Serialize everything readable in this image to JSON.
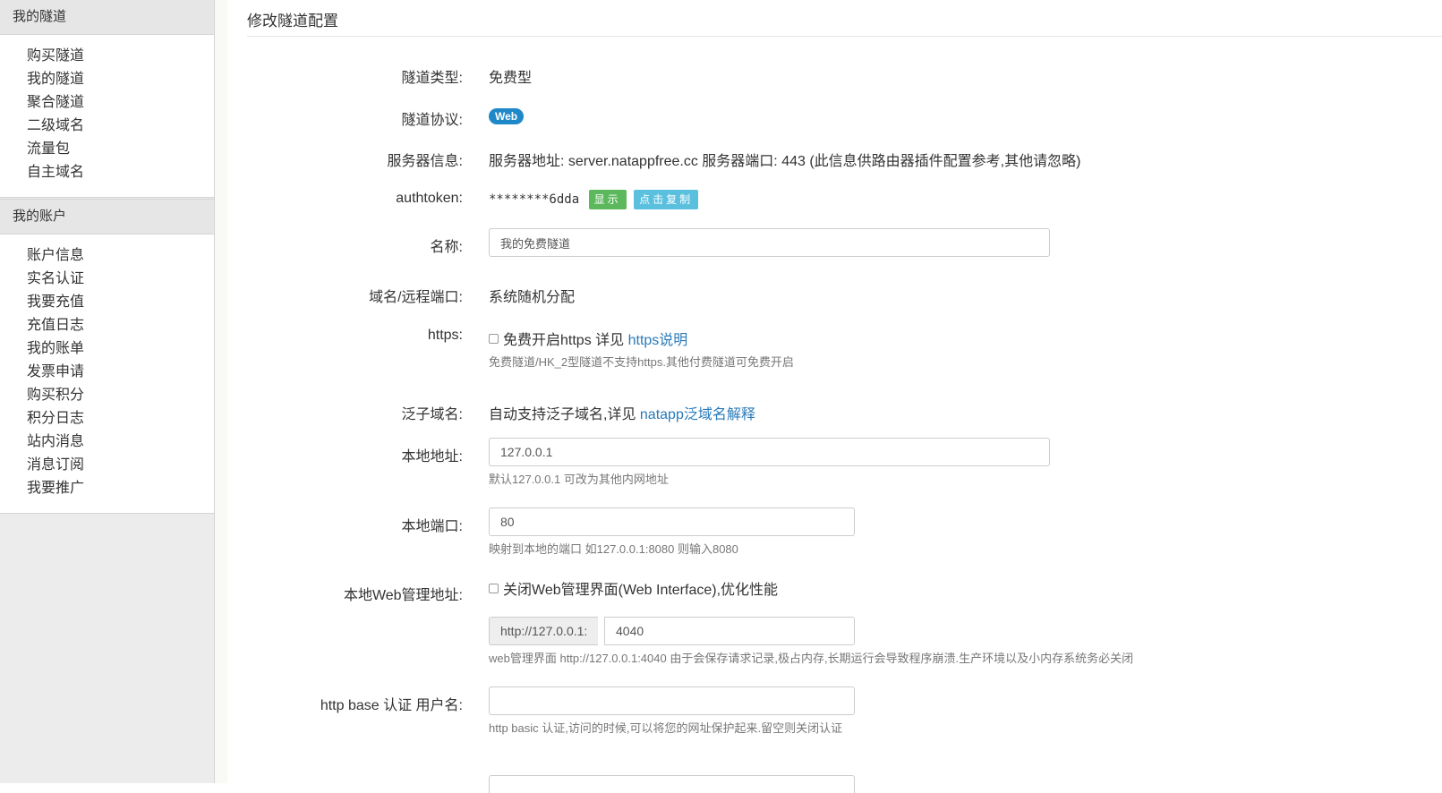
{
  "sidebar": {
    "groups": [
      {
        "header": "我的隧道",
        "items": [
          "购买隧道",
          "我的隧道",
          "聚合隧道",
          "二级域名",
          "流量包",
          "自主域名"
        ]
      },
      {
        "header": "我的账户",
        "items": [
          "账户信息",
          "实名认证",
          "我要充值",
          "充值日志",
          "我的账单",
          "发票申请",
          "购买积分",
          "积分日志",
          "站内消息",
          "消息订阅",
          "我要推广"
        ]
      }
    ]
  },
  "page": {
    "title": "修改隧道配置"
  },
  "form": {
    "tunnel_type": {
      "label": "隧道类型:",
      "value": "免费型"
    },
    "protocol": {
      "label": "隧道协议:",
      "badge": "Web"
    },
    "server": {
      "label": "服务器信息:",
      "value": "服务器地址: server.natappfree.cc 服务器端口: 443 (此信息供路由器插件配置参考,其他请忽略)"
    },
    "authtoken": {
      "label": "authtoken:",
      "masked": "********6dda",
      "show_button": "显示",
      "copy_button": "点击复制"
    },
    "name": {
      "label": "名称:",
      "value": "我的免费隧道"
    },
    "domain": {
      "label": "域名/远程端口:",
      "value": "系统随机分配"
    },
    "https": {
      "label": "https:",
      "checkbox_text": "免费开启https 详见",
      "link_text": "https说明",
      "help": "免费隧道/HK_2型隧道不支持https.其他付费隧道可免费开启"
    },
    "wildcard": {
      "label": "泛子域名:",
      "text": "自动支持泛子域名,详见",
      "link_text": "natapp泛域名解释"
    },
    "local_address": {
      "label": "本地地址:",
      "value": "127.0.0.1",
      "help": "默认127.0.0.1 可改为其他内网地址"
    },
    "local_port": {
      "label": "本地端口:",
      "value": "80",
      "help": "映射到本地的端口 如127.0.0.1:8080 则输入8080"
    },
    "web_interface": {
      "label": "本地Web管理地址:",
      "checkbox_text": "关闭Web管理界面(Web Interface),优化性能",
      "prefix": "http://127.0.0.1:",
      "value": "4040",
      "help": "web管理界面 http://127.0.0.1:4040 由于会保存请求记录,极占内存,长期运行会导致程序崩溃.生产环境以及小内存系统务必关闭"
    },
    "http_auth_user": {
      "label": "http base 认证 用户名:",
      "value": "",
      "help": "http basic 认证,访问的时候,可以将您的网址保护起来.留空则关闭认证"
    }
  }
}
